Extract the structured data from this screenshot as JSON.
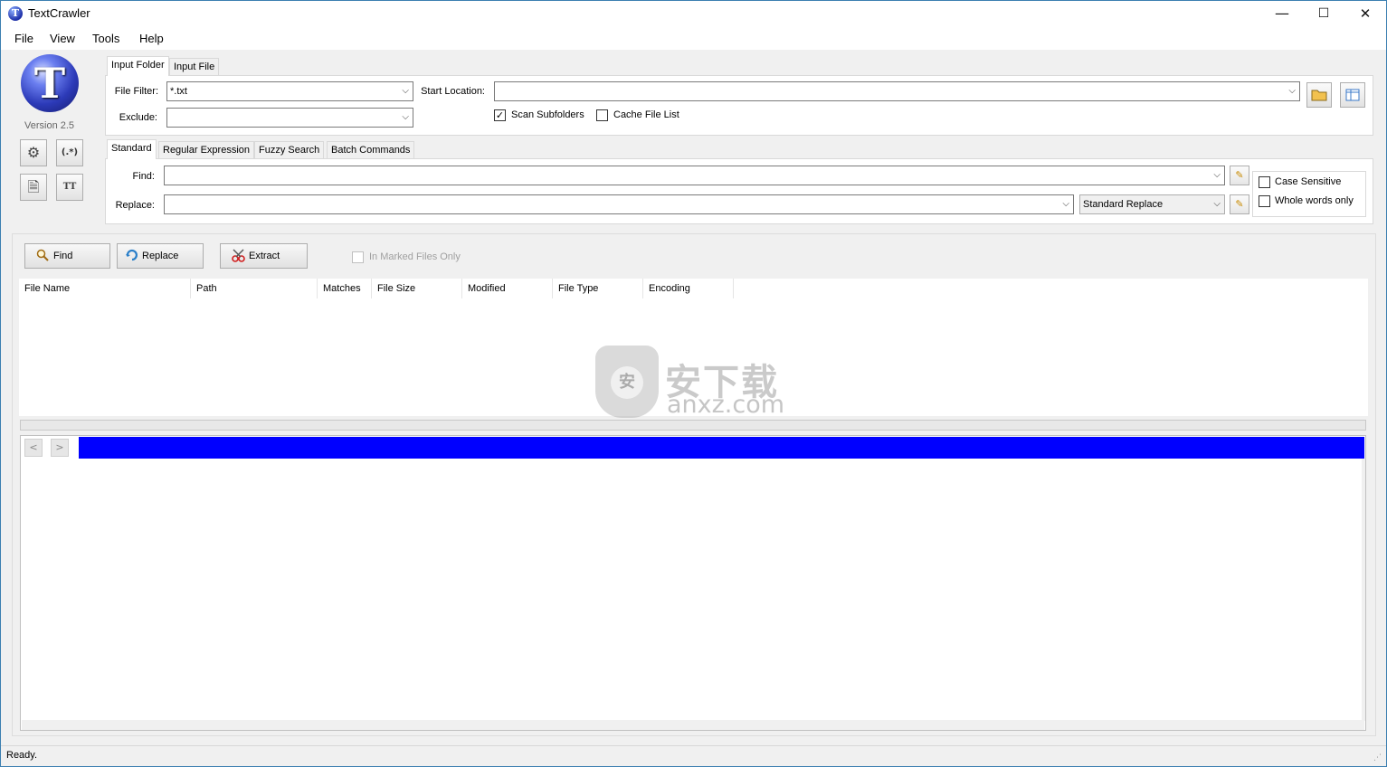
{
  "window": {
    "title": "TextCrawler",
    "app_icon_letter": "T",
    "minimize": "—",
    "maximize": "☐",
    "close": "✕"
  },
  "menu": [
    "File",
    "View",
    "Tools",
    "Help"
  ],
  "sidebar": {
    "logo_letter": "T",
    "version": "Version 2.5",
    "buttons": [
      {
        "name": "settings-icon",
        "glyph": "⚙"
      },
      {
        "name": "regex-icon",
        "glyph": "(.*)"
      },
      {
        "name": "document-icon",
        "glyph": "🗎"
      },
      {
        "name": "font-icon",
        "glyph": "TT"
      }
    ]
  },
  "input_panel": {
    "tabs": [
      "Input Folder",
      "Input File"
    ],
    "active_tab": "Input Folder",
    "file_filter_label": "File Filter:",
    "file_filter_value": "*.txt",
    "exclude_label": "Exclude:",
    "exclude_value": "",
    "start_location_label": "Start Location:",
    "start_location_value": "",
    "scan_subfolders_label": "Scan Subfolders",
    "scan_subfolders_checked": true,
    "cache_file_list_label": "Cache File List",
    "cache_file_list_checked": false,
    "dropdown_arrow": "⌵",
    "check_mark": "✓"
  },
  "search_panel": {
    "tabs": [
      "Standard",
      "Regular Expression",
      "Fuzzy Search",
      "Batch Commands"
    ],
    "active_tab": "Standard",
    "find_label": "Find:",
    "find_value": "",
    "replace_label": "Replace:",
    "replace_value": "",
    "replace_mode": "Standard Replace",
    "case_sensitive_label": "Case Sensitive",
    "whole_words_label": "Whole words only",
    "edit_glyph": "✎"
  },
  "actions": {
    "find_label": "Find",
    "replace_label": "Replace",
    "extract_label": "Extract",
    "marked_only_label": "In Marked Files Only"
  },
  "results": {
    "columns": [
      "File Name",
      "Path",
      "Matches",
      "File Size",
      "Modified",
      "File Type",
      "Encoding"
    ]
  },
  "preview": {
    "prev": "<",
    "next": ">"
  },
  "watermark": {
    "cn": "安下载",
    "en": "anxz.com",
    "shield_glyph": "安"
  },
  "status": {
    "text": "Ready."
  },
  "colors": {
    "preview_bar": "#0000ff",
    "window_border": "#3c7fb1"
  }
}
